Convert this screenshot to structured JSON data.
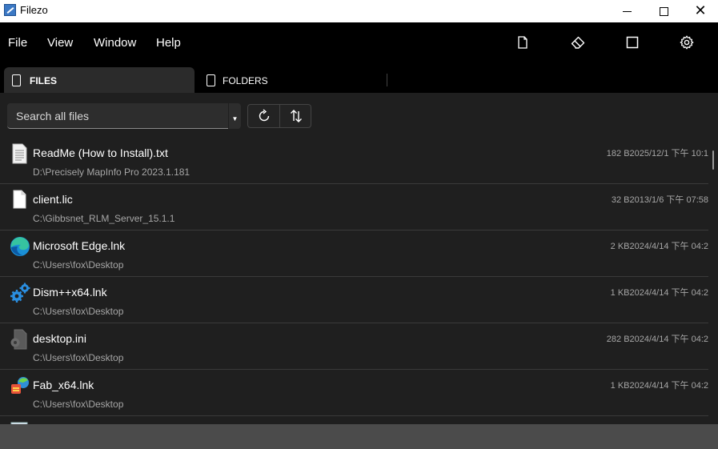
{
  "window": {
    "title": "Filezo",
    "minimize": "—",
    "maximize": "□",
    "close": "✕"
  },
  "menu": {
    "items": [
      "File",
      "View",
      "Window",
      "Help"
    ]
  },
  "toolbar": {
    "icons": [
      "document-icon",
      "eraser-icon",
      "square-icon",
      "gear-icon"
    ]
  },
  "tabs": [
    {
      "label": "FILES",
      "active": true
    },
    {
      "label": "FOLDERS",
      "active": false
    }
  ],
  "search": {
    "placeholder": "Search all files",
    "value": ""
  },
  "files": [
    {
      "name": "ReadMe (How to Install).txt",
      "path": "D:\\Precisely MapInfo Pro 2023.1.181",
      "size": "182 B",
      "date": "2025/12/1 下午 10:1",
      "icon": "text-file-icon"
    },
    {
      "name": "client.lic",
      "path": "C:\\Gibbsnet_RLM_Server_15.1.1",
      "size": "32 B",
      "date": "2013/1/6 下午 07:58",
      "icon": "blank-file-icon"
    },
    {
      "name": "Microsoft Edge.lnk",
      "path": "C:\\Users\\fox\\Desktop",
      "size": "2 KB",
      "date": "2024/4/14 下午 04:2",
      "icon": "edge-icon"
    },
    {
      "name": "Dism++x64.lnk",
      "path": "C:\\Users\\fox\\Desktop",
      "size": "1 KB",
      "date": "2024/4/14 下午 04:2",
      "icon": "gears-icon"
    },
    {
      "name": "desktop.ini",
      "path": "C:\\Users\\fox\\Desktop",
      "size": "282 B",
      "date": "2024/4/14 下午 04:2",
      "icon": "settings-file-icon"
    },
    {
      "name": "Fab_x64.lnk",
      "path": "C:\\Users\\fox\\Desktop",
      "size": "1 KB",
      "date": "2024/4/14 下午 04:2",
      "icon": "fab-icon"
    }
  ],
  "colors": {
    "background": "#000000",
    "content": "#1f1f1f",
    "tab_active": "#2b2b2b",
    "status_bar": "#4b4b4b",
    "secondary_text": "#a6a6a6"
  }
}
